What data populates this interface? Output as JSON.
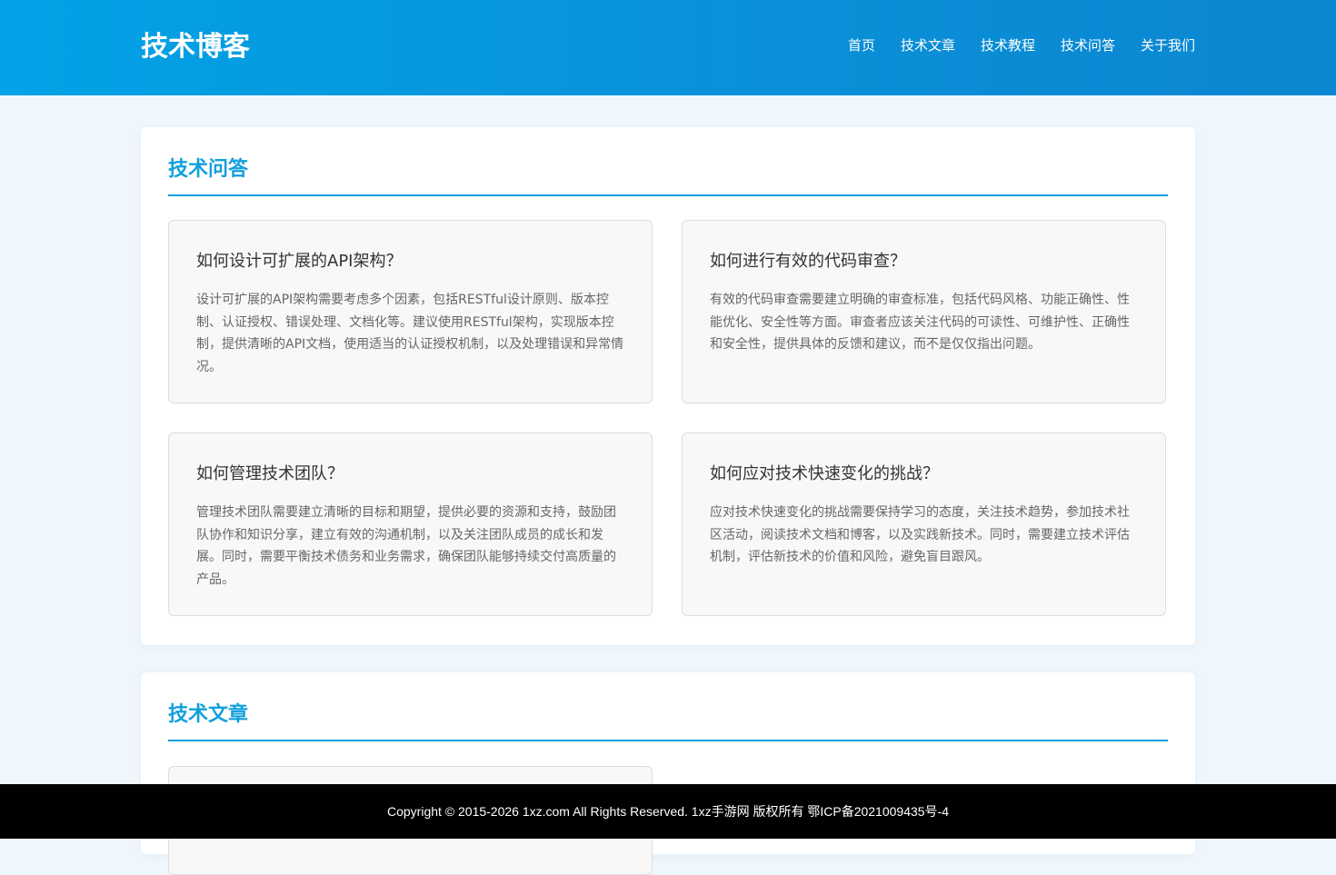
{
  "header": {
    "logo": "技术博客",
    "nav": [
      "首页",
      "技术文章",
      "技术教程",
      "技术问答",
      "关于我们"
    ]
  },
  "sections": [
    {
      "title": "技术问答",
      "cards": [
        {
          "title": "如何设计可扩展的API架构？",
          "desc": "设计可扩展的API架构需要考虑多个因素，包括RESTful设计原则、版本控制、认证授权、错误处理、文档化等。建议使用RESTful架构，实现版本控制，提供清晰的API文档，使用适当的认证授权机制，以及处理错误和异常情况。"
        },
        {
          "title": "如何进行有效的代码审查？",
          "desc": "有效的代码审查需要建立明确的审查标准，包括代码风格、功能正确性、性能优化、安全性等方面。审查者应该关注代码的可读性、可维护性、正确性和安全性，提供具体的反馈和建议，而不是仅仅指出问题。"
        },
        {
          "title": "如何管理技术团队？",
          "desc": "管理技术团队需要建立清晰的目标和期望，提供必要的资源和支持，鼓励团队协作和知识分享，建立有效的沟通机制，以及关注团队成员的成长和发展。同时，需要平衡技术债务和业务需求，确保团队能够持续交付高质量的产品。"
        },
        {
          "title": "如何应对技术快速变化的挑战？",
          "desc": "应对技术快速变化的挑战需要保持学习的态度，关注技术趋势，参加技术社区活动，阅读技术文档和博客，以及实践新技术。同时，需要建立技术评估机制，评估新技术的价值和风险，避免盲目跟风。"
        }
      ]
    },
    {
      "title": "技术文章"
    }
  ],
  "footer": {
    "copyright": "Copyright © 2015-2026 1xz.com All Rights Reserved. 1xz手游网 版权所有 鄂ICP备2021009435号-4"
  },
  "colors": {
    "header_start": "#03a2e6",
    "header_end": "#0b86d0",
    "accent": "#12a0dc",
    "page_bg": "#f0f7fc",
    "card_bg": "#f8f8f8",
    "footer_bg": "#000000"
  }
}
